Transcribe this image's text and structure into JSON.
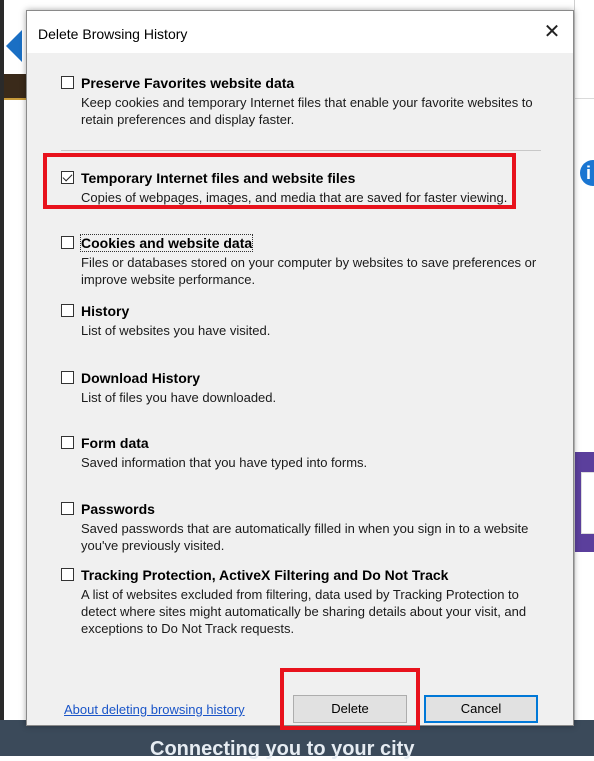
{
  "dialog": {
    "title": "Delete Browsing History",
    "close_glyph": "✕"
  },
  "options": [
    {
      "title": "Preserve Favorites website data",
      "description": "Keep cookies and temporary Internet files that enable your favorite websites to retain preferences and display faster.",
      "checked": false
    },
    {
      "title": "Temporary Internet files and website files",
      "description": "Copies of webpages, images, and media that are saved for faster viewing.",
      "checked": true
    },
    {
      "title": "Cookies and website data",
      "description": "Files or databases stored on your computer by websites to save preferences or improve website performance.",
      "checked": false
    },
    {
      "title": "History",
      "description": "List of websites you have visited.",
      "checked": false
    },
    {
      "title": "Download History",
      "description": "List of files you have downloaded.",
      "checked": false
    },
    {
      "title": "Form data",
      "description": "Saved information that you have typed into forms.",
      "checked": false
    },
    {
      "title": "Passwords",
      "description": "Saved passwords that are automatically filled in when you sign in to a website you've previously visited.",
      "checked": false
    },
    {
      "title": "Tracking Protection, ActiveX Filtering and Do Not Track",
      "description": "A list of websites excluded from filtering, data used by Tracking Protection to detect where sites might automatically be sharing details about your visit, and exceptions to Do Not Track requests.",
      "checked": false
    }
  ],
  "footer": {
    "about_link": "About deleting browsing history",
    "delete_label": "Delete",
    "cancel_label": "Cancel"
  },
  "background": {
    "bottom_banner_text": "Connecting you to your city"
  },
  "colors": {
    "highlight_red": "#e8121c",
    "link_blue": "#1a55c8",
    "default_button_border": "#0078d7"
  }
}
